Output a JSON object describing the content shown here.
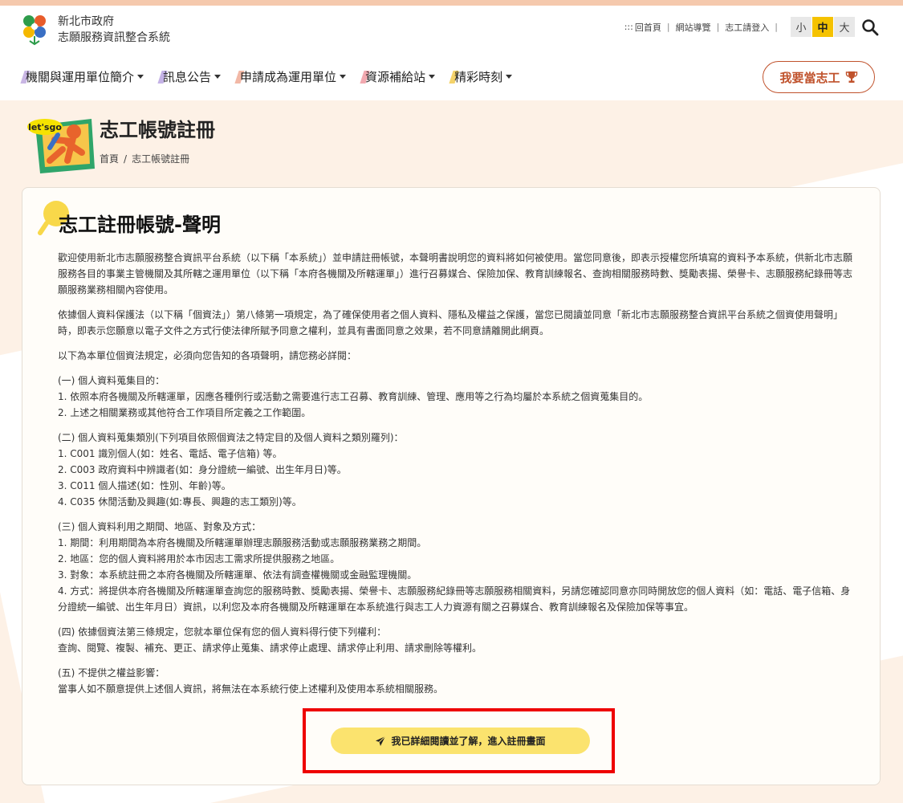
{
  "header": {
    "city": "新北市政府",
    "system": "志願服務資訊整合系統"
  },
  "util": {
    "home_prefix": ":::",
    "home": "回首頁",
    "sitemap": "網站導覽",
    "login": "志工請登入",
    "sizes": [
      "小",
      "中",
      "大"
    ]
  },
  "nav": {
    "items": [
      {
        "label": "機關與運用單位簡介"
      },
      {
        "label": "訊息公告"
      },
      {
        "label": "申請成為運用單位"
      },
      {
        "label": "資源補給站"
      },
      {
        "label": "精彩時刻"
      }
    ],
    "volunteer_button": "我要當志工"
  },
  "page": {
    "title": "志工帳號註冊",
    "breadcrumb": [
      "首頁",
      "志工帳號註冊"
    ],
    "logo_text": "let'sgo"
  },
  "card": {
    "title": "志工註冊帳號-聲明",
    "paragraphs": [
      "歡迎使用新北市志願服務整合資訊平台系統（以下稱「本系統」）並申請註冊帳號，本聲明書說明您的資料將如何被使用。當您同意後，即表示授權您所填寫的資料予本系統，供新北市志願服務各目的事業主管機關及其所轄之運用單位（以下稱「本府各機關及所轄運單」）進行召募媒合、保險加保、教育訓練報名、查詢相關服務時數、獎勵表揚、榮譽卡、志願服務紀錄冊等志願服務業務相關內容使用。",
      "依據個人資料保護法（以下稱「個資法」）第八條第一項規定，為了確保使用者之個人資料、隱私及權益之保護，當您已閱讀並同意「新北市志願服務整合資訊平台系統之個資使用聲明」時，即表示您願意以電子文件之方式行使法律所賦予同意之權利，並具有書面同意之效果，若不同意請離開此網頁。",
      "以下為本單位個資法規定，必須向您告知的各項聲明，請您務必詳閱："
    ],
    "sections": [
      {
        "heading": "(一) 個人資料蒐集目的：",
        "lines": [
          "1. 依照本府各機關及所轄運單，因應各種例行或活動之需要進行志工召募、教育訓練、管理、應用等之行為均屬於本系統之個資蒐集目的。",
          "2. 上述之相關業務或其他符合工作項目所定義之工作範圍。"
        ]
      },
      {
        "heading": "(二) 個人資料蒐集類別(下列項目依照個資法之特定目的及個人資料之類別羅列)：",
        "lines": [
          "1. C001 識別個人(如：姓名、電話、電子信箱) 等。",
          "2. C003 政府資料中辨識者(如：身分證統一編號、出生年月日)等。",
          "3. C011 個人描述(如：性別、年齡)等。",
          "4. C035 休閒活動及興趣(如:專長、興趣的志工類別)等。"
        ]
      },
      {
        "heading": "(三) 個人資料利用之期間、地區、對象及方式：",
        "lines": [
          "1. 期間：利用期間為本府各機關及所轄運單辦理志願服務活動或志願服務業務之期間。",
          "2. 地區：您的個人資料將用於本市因志工需求所提供服務之地區。",
          "3. 對象：本系統註冊之本府各機關及所轄運單、依法有調查權機關或金融監理機關。",
          "4. 方式：將提供本府各機關及所轄運單查詢您的服務時數、獎勵表揚、榮譽卡、志願服務紀錄冊等志願服務相關資料，另請您確認同意亦同時開放您的個人資料（如：電話、電子信箱、身分證統一編號、出生年月日）資訊，以利您及本府各機關及所轄運單在本系統進行與志工人力資源有關之召募媒合、教育訓練報名及保險加保等事宜。"
        ]
      },
      {
        "heading": "(四) 依據個資法第三條規定，您就本單位保有您的個人資料得行使下列權利：",
        "lines": [
          "查詢、閱覽、複製、補充、更正、請求停止蒐集、請求停止處理、請求停止利用、請求刪除等權利。"
        ]
      },
      {
        "heading": "(五) 不提供之權益影響：",
        "lines": [
          "當事人如不願意提供上述個人資訊，將無法在本系統行使上述權利及使用本系統相關服務。"
        ]
      }
    ],
    "cta": "我已詳細閱讀並了解，進入註冊畫面"
  }
}
